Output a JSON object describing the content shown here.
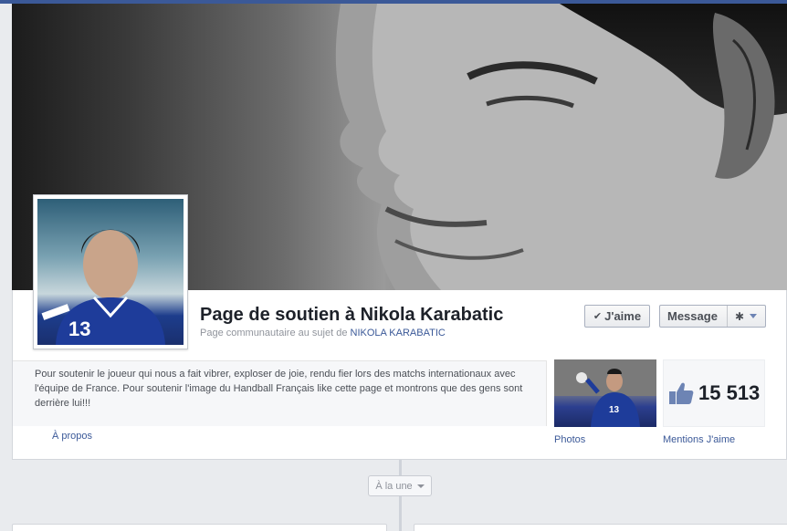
{
  "page": {
    "title": "Page de soutien à Nikola Karabatic",
    "subtitle_prefix": "Page communautaire au sujet de ",
    "subtitle_link": "NIKOLA KARABATIC"
  },
  "actions": {
    "like_label": "J'aime",
    "message_label": "Message"
  },
  "about": {
    "description": "Pour soutenir le joueur qui nous a fait vibrer, exploser de joie, rendu fier lors des matchs internationaux avec l'équipe de France. Pour soutenir l'image du Handball Français like cette page et montrons que des gens sont derrière lui!!!",
    "link_label": "À propos"
  },
  "apps": {
    "photos_label": "Photos",
    "likes_count": "15 513",
    "likes_label": "Mentions J'aime"
  },
  "timeline": {
    "filter_label": "À la une"
  },
  "colors": {
    "brand_blue": "#3b5998",
    "background": "#e9ebee"
  },
  "icons": [
    "check-icon",
    "gear-icon",
    "caret-down-icon",
    "thumbs-up-icon"
  ]
}
